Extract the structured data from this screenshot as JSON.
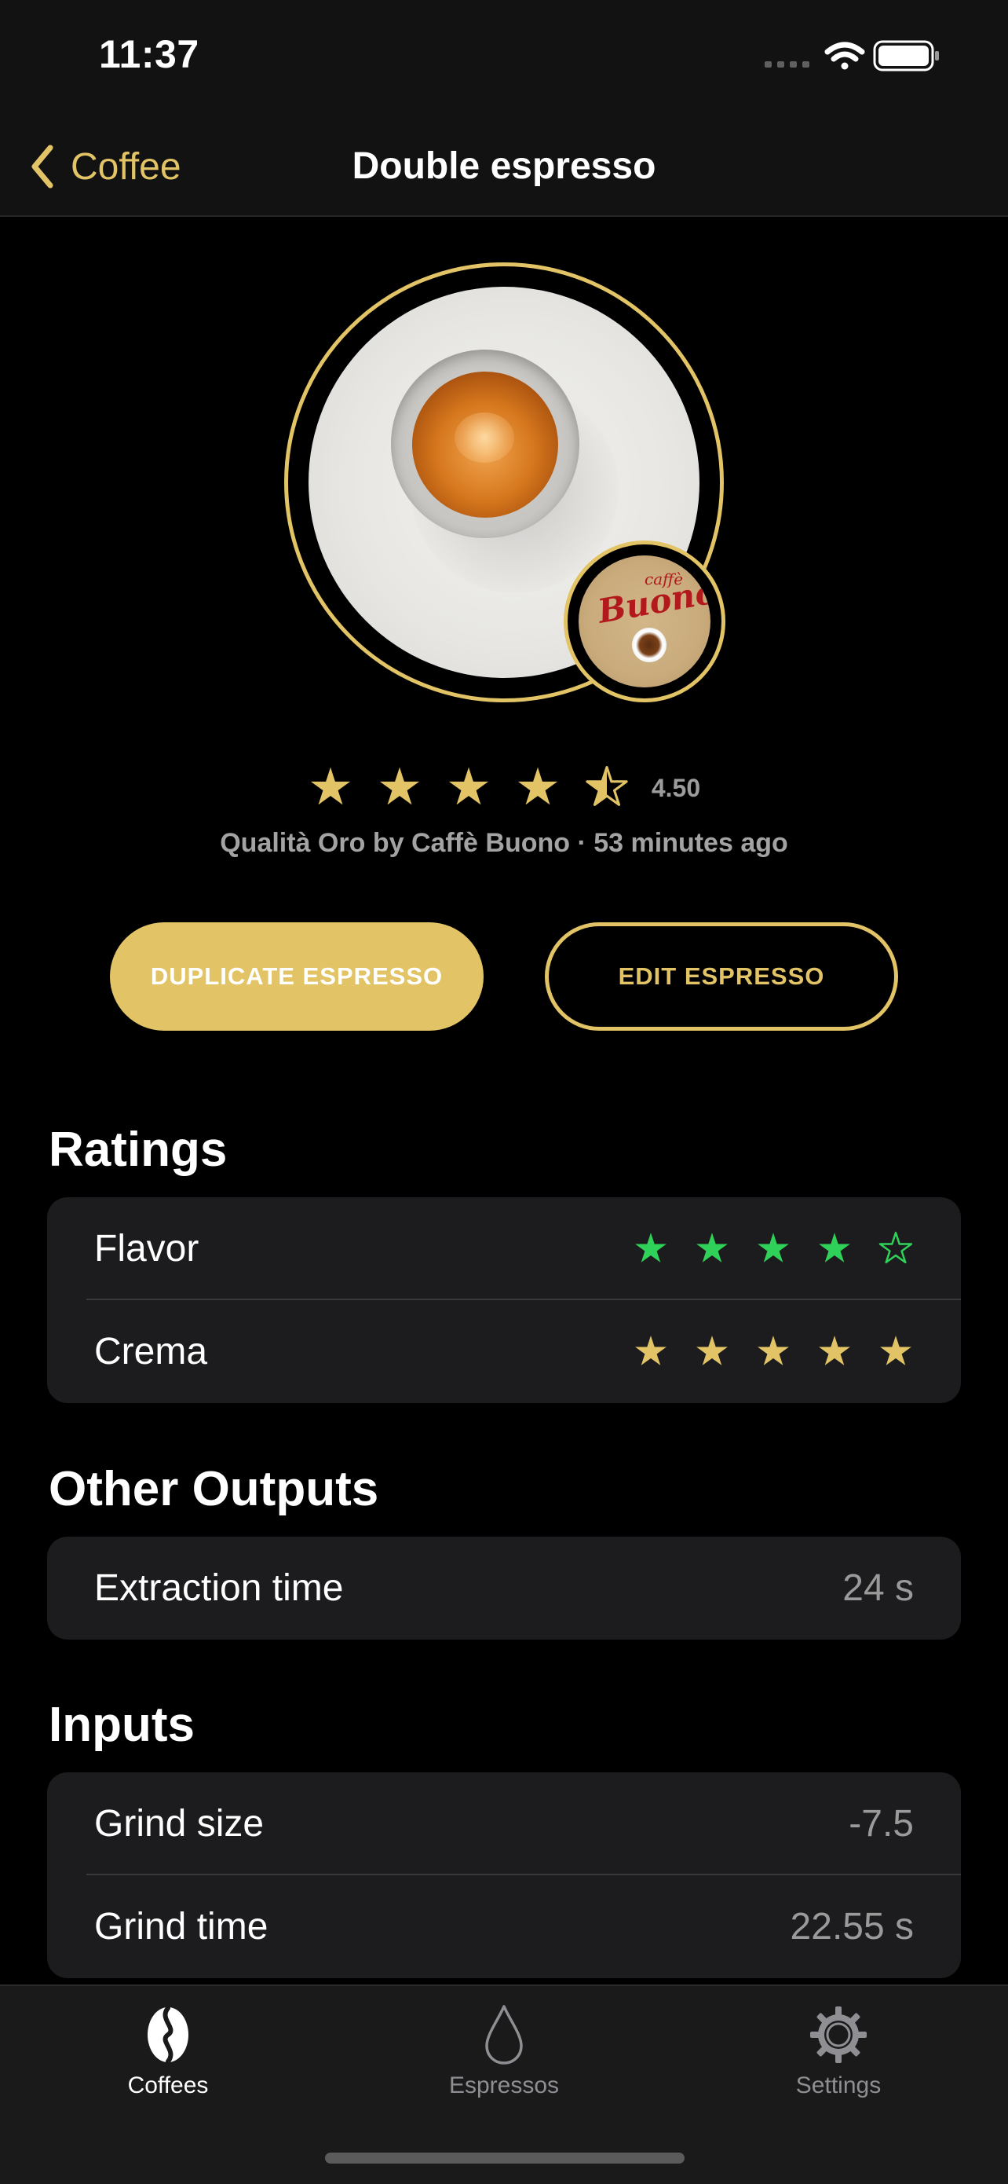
{
  "status_bar": {
    "time": "11:37"
  },
  "nav": {
    "back_label": "Coffee",
    "title": "Double espresso"
  },
  "hero": {
    "image": "espresso-cup-photo",
    "badge": {
      "caffe": "caffè",
      "name": "Buono"
    }
  },
  "summary": {
    "rating_value": "4.50",
    "rating": 4.5,
    "rating_max": 5,
    "subtitle": "Qualità Oro by Caffè Buono · 53 minutes ago"
  },
  "actions": {
    "duplicate_label": "DUPLICATE ESPRESSO",
    "edit_label": "EDIT ESPRESSO"
  },
  "sections": {
    "ratings": {
      "title": "Ratings",
      "items": [
        {
          "label": "Flavor",
          "stars": 4,
          "max": 5,
          "color": "#30d158"
        },
        {
          "label": "Crema",
          "stars": 5,
          "max": 5,
          "color": "#e2c466"
        }
      ]
    },
    "other_outputs": {
      "title": "Other Outputs",
      "items": [
        {
          "label": "Extraction time",
          "value": "24 s"
        }
      ]
    },
    "inputs": {
      "title": "Inputs",
      "items": [
        {
          "label": "Grind size",
          "value": "-7.5"
        },
        {
          "label": "Grind time",
          "value": "22.55 s"
        }
      ]
    }
  },
  "tab_bar": {
    "items": [
      {
        "label": "Coffees",
        "icon": "coffee-bean-icon",
        "active": true
      },
      {
        "label": "Espressos",
        "icon": "drop-icon",
        "active": false
      },
      {
        "label": "Settings",
        "icon": "gear-icon",
        "active": false
      }
    ]
  },
  "colors": {
    "accent": "#e2c466",
    "flavor_green": "#30d158",
    "background": "#000000",
    "card": "#1c1c1e"
  }
}
